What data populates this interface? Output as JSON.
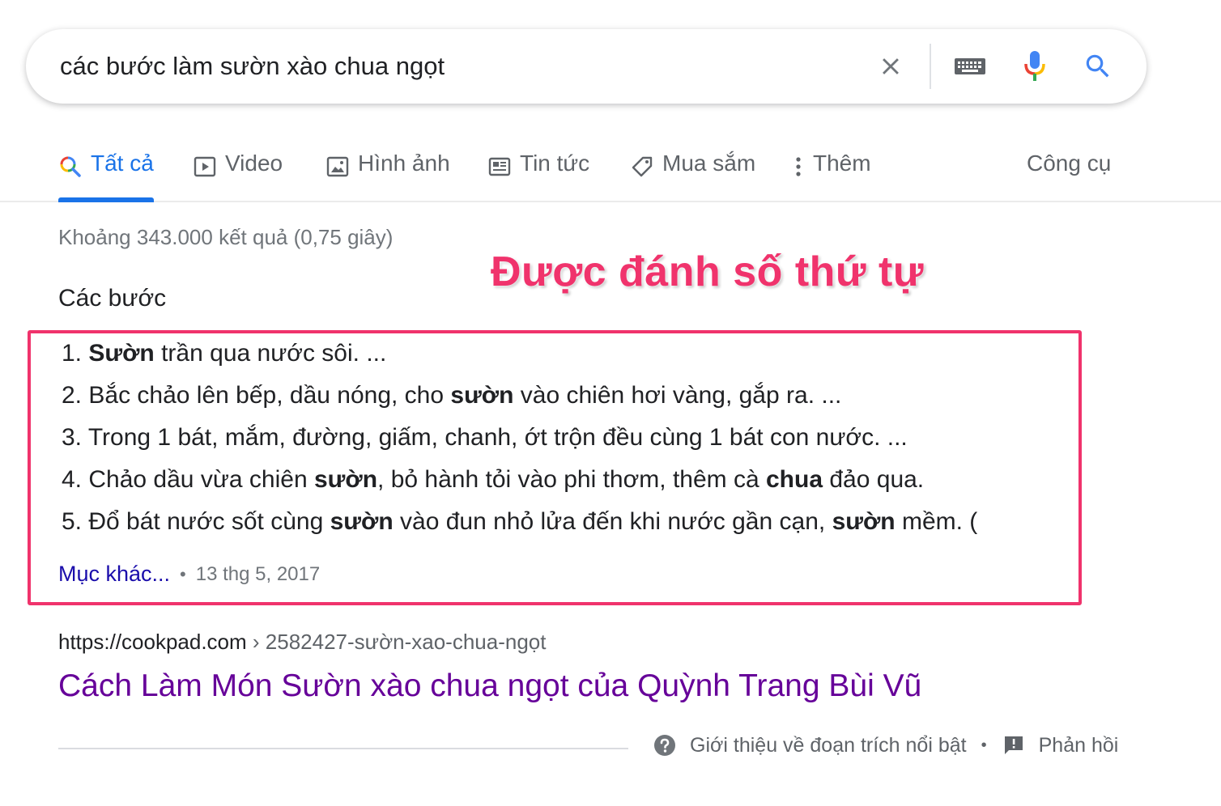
{
  "search": {
    "query": "các bước làm sườn xào chua ngọt",
    "icons": [
      "close-icon",
      "keyboard-icon",
      "mic-icon",
      "search-icon"
    ]
  },
  "tabs": [
    {
      "label": "Tất cả",
      "icon": "search-multicolor-icon",
      "active": true
    },
    {
      "label": "Video",
      "icon": "play-icon"
    },
    {
      "label": "Hình ảnh",
      "icon": "image-icon"
    },
    {
      "label": "Tin tức",
      "icon": "news-icon"
    },
    {
      "label": "Mua sắm",
      "icon": "tag-icon"
    },
    {
      "label": "Thêm",
      "icon": "more-vert-icon"
    }
  ],
  "tools_label": "Công cụ",
  "result_stats": "Khoảng 343.000 kết quả (0,75 giây)",
  "annotation": "Được đánh số thứ tự",
  "snippet": {
    "title": "Các bước",
    "steps": [
      {
        "n": "1.",
        "parts": [
          {
            "t": "Sườn",
            "b": true
          },
          {
            "t": " trần qua nước sôi. ..."
          }
        ]
      },
      {
        "n": "2.",
        "parts": [
          {
            "t": "Bắc chảo lên bếp, dầu nóng, cho "
          },
          {
            "t": "sườn",
            "b": true
          },
          {
            "t": " vào chiên hơi vàng, gắp ra. ..."
          }
        ]
      },
      {
        "n": "3.",
        "parts": [
          {
            "t": "Trong 1 bát, mắm, đường, giấm, chanh, ớt trộn đều cùng 1 bát con nước. ..."
          }
        ]
      },
      {
        "n": "4.",
        "parts": [
          {
            "t": "Chảo dầu vừa chiên "
          },
          {
            "t": "sườn",
            "b": true
          },
          {
            "t": ", bỏ hành tỏi vào phi thơm, thêm cà "
          },
          {
            "t": "chua",
            "b": true
          },
          {
            "t": " đảo qua."
          }
        ]
      },
      {
        "n": "5.",
        "parts": [
          {
            "t": "Đổ bát nước sốt cùng "
          },
          {
            "t": "sườn",
            "b": true
          },
          {
            "t": " vào đun nhỏ lửa đến khi nước gần cạn, "
          },
          {
            "t": "sườn",
            "b": true
          },
          {
            "t": " mềm. ("
          }
        ]
      }
    ],
    "more_label": "Mục khác...",
    "separator": "•",
    "date": "13 thg 5, 2017"
  },
  "result": {
    "host": "https://cookpad.com",
    "path": " › 2582427-sườn-xao-chua-ngọt",
    "title": "Cách Làm Món Sườn xào chua ngọt của Quỳnh Trang Bùi Vũ"
  },
  "footer": {
    "about_label": "Giới thiệu về đoạn trích nổi bật",
    "separator": "•",
    "feedback_label": "Phản hồi"
  },
  "colors": {
    "accent": "#1a73e8",
    "highlight": "#f0336c",
    "visited_link": "#660099",
    "link": "#1a0dab"
  }
}
